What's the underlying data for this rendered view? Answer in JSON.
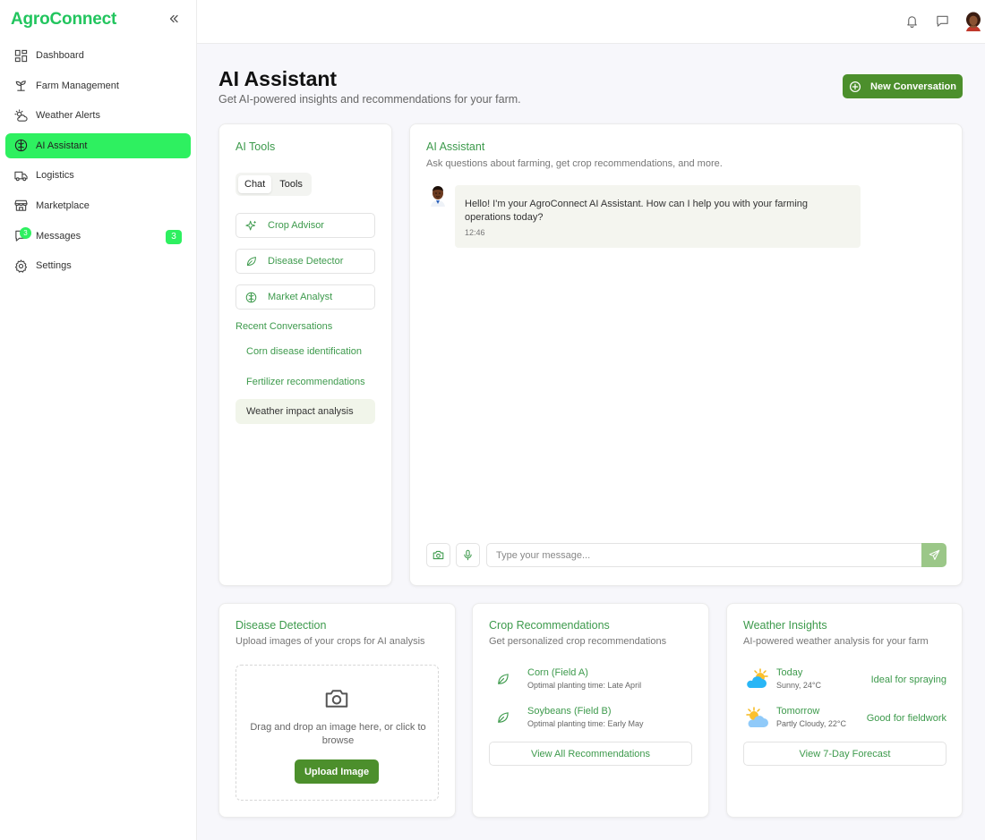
{
  "app": {
    "brand": "AgroConnect"
  },
  "sidebar": {
    "items": [
      {
        "label": "Dashboard",
        "icon": "dashboard-icon"
      },
      {
        "label": "Farm Management",
        "icon": "sprout-icon"
      },
      {
        "label": "Weather Alerts",
        "icon": "cloud-sun-icon"
      },
      {
        "label": "AI Assistant",
        "icon": "brain-icon",
        "active": true
      },
      {
        "label": "Logistics",
        "icon": "truck-icon"
      },
      {
        "label": "Marketplace",
        "icon": "store-icon"
      },
      {
        "label": "Messages",
        "icon": "message-icon",
        "badge": "3",
        "icon_badge": "3"
      },
      {
        "label": "Settings",
        "icon": "gear-icon"
      }
    ]
  },
  "header": {
    "title": "AI Assistant",
    "subtitle": "Get AI-powered insights and recommendations for your farm.",
    "new_conversation": "New Conversation"
  },
  "ai_tools": {
    "title": "AI Tools",
    "tabs": [
      "Chat",
      "Tools"
    ],
    "tools": [
      "Crop Advisor",
      "Disease Detector",
      "Market Analyst"
    ],
    "recent_title": "Recent Conversations",
    "recent": [
      "Corn disease identification",
      "Fertilizer recommendations",
      "Weather impact analysis"
    ]
  },
  "chat": {
    "title": "AI Assistant",
    "subtitle": "Ask questions about farming, get crop recommendations, and more.",
    "message": "Hello! I'm your AgroConnect AI Assistant. How can I help you with your farming operations today?",
    "time": "12:46",
    "placeholder": "Type your message..."
  },
  "disease": {
    "title": "Disease Detection",
    "subtitle": "Upload images of your crops for AI analysis",
    "drop_text": "Drag and drop an image here, or click to browse",
    "upload": "Upload Image"
  },
  "crops": {
    "title": "Crop Recommendations",
    "subtitle": "Get personalized crop recommendations",
    "items": [
      {
        "name": "Corn (Field A)",
        "detail": "Optimal planting time: Late April"
      },
      {
        "name": "Soybeans (Field B)",
        "detail": "Optimal planting time: Early May"
      }
    ],
    "button": "View All Recommendations"
  },
  "weather": {
    "title": "Weather Insights",
    "subtitle": "AI-powered weather analysis for your farm",
    "items": [
      {
        "day": "Today",
        "cond": "Sunny, 24°C",
        "note": "Ideal for spraying"
      },
      {
        "day": "Tomorrow",
        "cond": "Partly Cloudy, 22°C",
        "note": "Good for fieldwork"
      }
    ],
    "button": "View 7-Day Forecast"
  },
  "colors": {
    "accent": "#2ef060",
    "primary": "#4c8f2c",
    "text_green": "#3d9a4c"
  }
}
